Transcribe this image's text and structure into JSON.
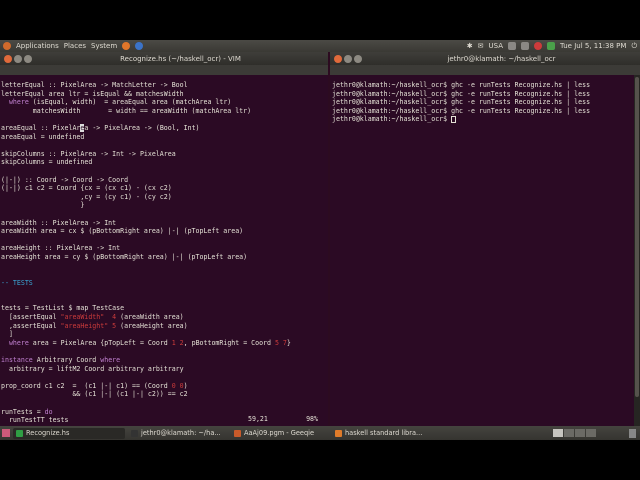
{
  "top_panel": {
    "applications": "Applications",
    "places": "Places",
    "system": "System",
    "keyboard": "USA",
    "clock": "Tue Jul 5, 11:38 PM"
  },
  "vim": {
    "title": "Recognize.hs (~/haskell_ocr) - VIM",
    "status_pos": "59,21",
    "status_pct": "98%",
    "lines": [
      [
        {
          "t": "letterEqual :: PixelArea -> MatchLetter -> Bool"
        }
      ],
      [
        {
          "t": "letterEqual area ltr = isEqual && matchesWidth"
        }
      ],
      [
        {
          "t": "  "
        },
        {
          "t": "where",
          "c": "kw"
        },
        {
          "t": " (isEqual, width)  = areaEqual area (matchArea ltr)"
        }
      ],
      [
        {
          "t": "        matchesWidth       = width == areaWidth (matchArea ltr)"
        }
      ],
      [
        {
          "t": ""
        }
      ],
      [
        {
          "t": "areaEqual :: PixelAr"
        },
        {
          "t": "e",
          "c": "cursor"
        },
        {
          "t": "a -> PixelArea -> (Bool, Int)"
        }
      ],
      [
        {
          "t": "areaEqual = undefined"
        }
      ],
      [
        {
          "t": ""
        }
      ],
      [
        {
          "t": "skipColumns :: PixelArea -> Int -> PixelArea"
        }
      ],
      [
        {
          "t": "skipColumns = undefined"
        }
      ],
      [
        {
          "t": ""
        }
      ],
      [
        {
          "t": "(|-|) :: Coord -> Coord -> Coord"
        }
      ],
      [
        {
          "t": "(|-|) c1 c2 = Coord {cx = (cx c1) - (cx c2)"
        }
      ],
      [
        {
          "t": "                    ,cy = (cy c1) - (cy c2)"
        }
      ],
      [
        {
          "t": "                    }"
        }
      ],
      [
        {
          "t": ""
        }
      ],
      [
        {
          "t": "areaWidth :: PixelArea -> Int"
        }
      ],
      [
        {
          "t": "areaWidth area = cx $ (pBottomRight area) |-| (pTopLeft area)"
        }
      ],
      [
        {
          "t": ""
        }
      ],
      [
        {
          "t": "areaHeight :: PixelArea -> Int"
        }
      ],
      [
        {
          "t": "areaHeight area = cy $ (pBottomRight area) |-| (pTopLeft area)"
        }
      ],
      [
        {
          "t": ""
        }
      ],
      [
        {
          "t": ""
        }
      ],
      [
        {
          "t": "-- TESTS",
          "c": "com"
        }
      ],
      [
        {
          "t": ""
        }
      ],
      [
        {
          "t": ""
        }
      ],
      [
        {
          "t": "tests = TestList $ map TestCase"
        }
      ],
      [
        {
          "t": "  [assertEqual "
        },
        {
          "t": "\"areaWidth\"",
          "c": "str"
        },
        {
          "t": "  "
        },
        {
          "t": "4",
          "c": "num"
        },
        {
          "t": " (areaWidth area)"
        }
      ],
      [
        {
          "t": "  ,assertEqual "
        },
        {
          "t": "\"areaHeight\"",
          "c": "str"
        },
        {
          "t": " "
        },
        {
          "t": "5",
          "c": "num"
        },
        {
          "t": " (areaHeight area)"
        }
      ],
      [
        {
          "t": "  ]"
        }
      ],
      [
        {
          "t": "  "
        },
        {
          "t": "where",
          "c": "kw"
        },
        {
          "t": " area = PixelArea {pTopLeft = Coord "
        },
        {
          "t": "1 2",
          "c": "num"
        },
        {
          "t": ", pBottomRight = Coord "
        },
        {
          "t": "5 7",
          "c": "num"
        },
        {
          "t": "}"
        }
      ],
      [
        {
          "t": ""
        }
      ],
      [
        {
          "t": "instance",
          "c": "kw"
        },
        {
          "t": " Arbitrary Coord "
        },
        {
          "t": "where",
          "c": "kw"
        }
      ],
      [
        {
          "t": "  arbitrary = liftM2 Coord arbitrary arbitrary"
        }
      ],
      [
        {
          "t": ""
        }
      ],
      [
        {
          "t": "prop_coord c1 c2  =  (c1 |-| c1) == (Coord "
        },
        {
          "t": "0 0",
          "c": "num"
        },
        {
          "t": ")"
        }
      ],
      [
        {
          "t": "                  && (c1 |-| (c1 |-| c2)) == c2"
        }
      ],
      [
        {
          "t": ""
        }
      ],
      [
        {
          "t": "runTests = "
        },
        {
          "t": "do",
          "c": "kw"
        }
      ],
      [
        {
          "t": "  runTestTT tests"
        }
      ]
    ]
  },
  "terminal": {
    "title": "jethr0@klamath: ~/haskell_ocr",
    "lines": [
      "jethr0@klamath:~/haskell_ocr$ ghc -e runTests Recognize.hs | less",
      "jethr0@klamath:~/haskell_ocr$ ghc -e runTests Recognize.hs | less",
      "jethr0@klamath:~/haskell_ocr$ ghc -e runTests Recognize.hs | less",
      "jethr0@klamath:~/haskell_ocr$ ghc -e runTests Recognize.hs | less"
    ],
    "prompt": "jethr0@klamath:~/haskell_ocr$ "
  },
  "taskbar": [
    {
      "label": "Recognize.hs",
      "icon_color": "#2f9e44",
      "active": true
    },
    {
      "label": "jethr0@klamath: ~/ha...",
      "icon_color": "#333333",
      "active": false
    },
    {
      "label": "AaAj09.pgm - Geeqie",
      "icon_color": "#c85a2a",
      "active": false
    },
    {
      "label": "haskell standard libra...",
      "icon_color": "#e07b2a",
      "active": false
    }
  ],
  "colors": {
    "desktop": "#2c0b20",
    "panel": "#3c3b37"
  }
}
